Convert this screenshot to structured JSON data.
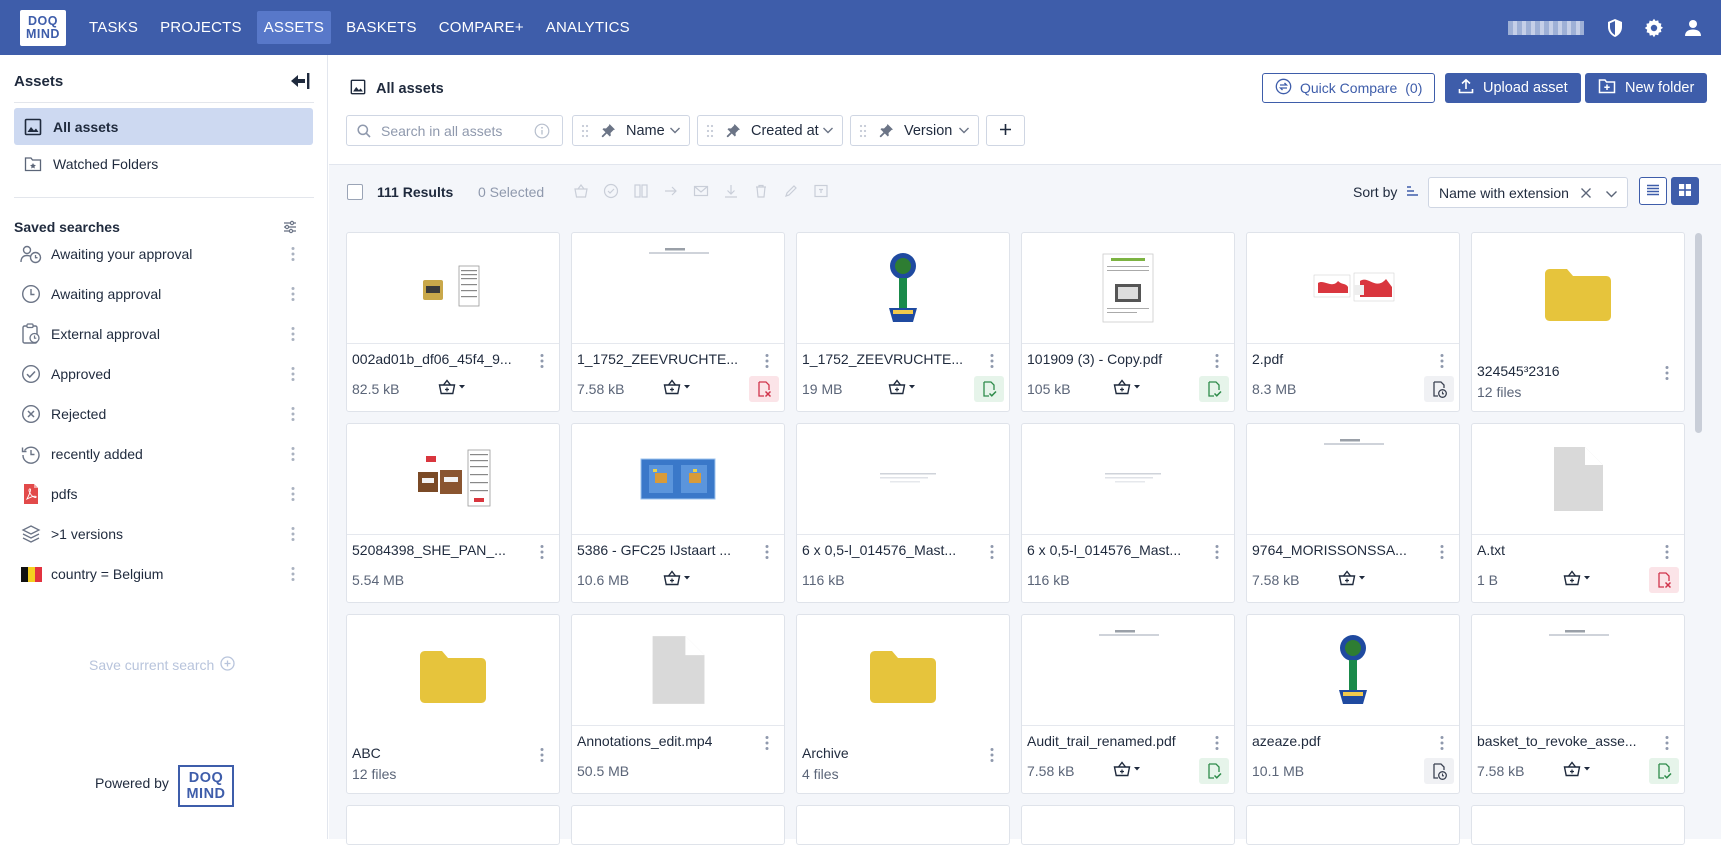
{
  "nav": {
    "logo_top": "DOQ",
    "logo_bottom": "MIND",
    "items": [
      {
        "label": "TASKS"
      },
      {
        "label": "PROJECTS"
      },
      {
        "label": "ASSETS"
      },
      {
        "label": "BASKETS"
      },
      {
        "label": "COMPARE+"
      },
      {
        "label": "ANALYTICS"
      }
    ],
    "active": "ASSETS"
  },
  "sidebar": {
    "title": "Assets",
    "items": [
      {
        "label": "All assets"
      },
      {
        "label": "Watched Folders"
      }
    ],
    "saved_title": "Saved searches",
    "saved": [
      {
        "label": "Awaiting your approval",
        "icon": "user-clock-icon"
      },
      {
        "label": "Awaiting approval",
        "icon": "clock-icon"
      },
      {
        "label": "External approval",
        "icon": "clipboard-clock-icon"
      },
      {
        "label": "Approved",
        "icon": "check-circle-icon"
      },
      {
        "label": "Rejected",
        "icon": "x-circle-icon"
      },
      {
        "label": "recently added",
        "icon": "history-icon"
      },
      {
        "label": "pdfs",
        "icon": "pdf-icon"
      },
      {
        "label": ">1 versions",
        "icon": "layers-icon"
      },
      {
        "label": "country = Belgium",
        "icon": "belgium-flag-icon"
      }
    ],
    "save_current": "Save current search",
    "powered_by": "Powered by"
  },
  "header": {
    "title": "All assets",
    "quick_compare": "Quick Compare",
    "quick_compare_count": "(0)",
    "upload": "Upload asset",
    "new_folder": "New folder",
    "search_placeholder": "Search in all assets",
    "filters": [
      {
        "label": "Name"
      },
      {
        "label": "Created at"
      },
      {
        "label": "Version"
      }
    ]
  },
  "results": {
    "count": "111 Results",
    "selected": "0 Selected",
    "sort_label": "Sort by",
    "sort_value": "Name with extension"
  },
  "colors": {
    "primary": "#3e5daa",
    "folder": "#e6c43c",
    "ok": "#2e8b4a",
    "bad": "#d0344c"
  },
  "assets": [
    {
      "name": "002ad01b_df06_45f4_9...",
      "meta": "82.5 kB",
      "type": "file",
      "thumb": "pack",
      "status": "",
      "basket": true
    },
    {
      "name": "1_1752_ZEEVRUCHTE...",
      "meta": "7.58 kB",
      "type": "file",
      "thumb": "doc",
      "status": "bad",
      "basket": true
    },
    {
      "name": "1_1752_ZEEVRUCHTE...",
      "meta": "19 MB",
      "type": "file",
      "thumb": "label",
      "status": "ok",
      "basket": true
    },
    {
      "name": "101909 (3) - Copy.pdf",
      "meta": "105 kB",
      "type": "file",
      "thumb": "sheet",
      "status": "ok",
      "basket": true
    },
    {
      "name": "2.pdf",
      "meta": "8.3 MB",
      "type": "file",
      "thumb": "red",
      "status": "pend",
      "basket": false
    },
    {
      "name": "324545³2316",
      "meta": "12 files",
      "type": "folder",
      "thumb": "folder",
      "status": "",
      "basket": false
    },
    {
      "name": "52084398_SHE_PAN_...",
      "meta": "5.54 MB",
      "type": "file",
      "thumb": "brown",
      "status": "",
      "basket": false
    },
    {
      "name": "5386 - GFC25 IJstaart ...",
      "meta": "10.6 MB",
      "type": "file",
      "thumb": "blue",
      "status": "",
      "basket": true
    },
    {
      "name": "6 x 0,5-l_014576_Mast...",
      "meta": "116 kB",
      "type": "file",
      "thumb": "faint",
      "status": "",
      "basket": false
    },
    {
      "name": "6 x 0,5-l_014576_Mast...",
      "meta": "116 kB",
      "type": "file",
      "thumb": "faint",
      "status": "",
      "basket": false
    },
    {
      "name": "9764_MORISSONSSA...",
      "meta": "7.58 kB",
      "type": "file",
      "thumb": "doc",
      "status": "",
      "basket": true
    },
    {
      "name": "A.txt",
      "meta": "1 B",
      "type": "file",
      "thumb": "generic",
      "status": "bad",
      "basket": true
    },
    {
      "name": "ABC",
      "meta": "12 files",
      "type": "folder",
      "thumb": "folder",
      "status": "",
      "basket": false
    },
    {
      "name": "Annotations_edit.mp4",
      "meta": "50.5 MB",
      "type": "file",
      "thumb": "generic-big",
      "status": "",
      "basket": false
    },
    {
      "name": "Archive",
      "meta": "4 files",
      "type": "folder",
      "thumb": "folder",
      "status": "",
      "basket": false
    },
    {
      "name": "Audit_trail_renamed.pdf",
      "meta": "7.58 kB",
      "type": "file",
      "thumb": "doc",
      "status": "ok",
      "basket": true
    },
    {
      "name": "azeaze.pdf",
      "meta": "10.1 MB",
      "type": "file",
      "thumb": "label",
      "status": "pend",
      "basket": false
    },
    {
      "name": "basket_to_revoke_asse...",
      "meta": "7.58 kB",
      "type": "file",
      "thumb": "doc",
      "status": "ok",
      "basket": true
    }
  ]
}
